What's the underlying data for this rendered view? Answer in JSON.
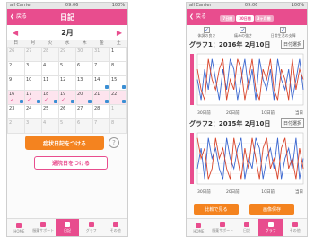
{
  "status_bar": {
    "carrier": "all Carrier",
    "time": "09:06",
    "battery": "100%"
  },
  "diary": {
    "back": "戻る",
    "title": "日記",
    "month": "2月",
    "prev": "◀",
    "next": "▶",
    "weekdays": [
      "日",
      "月",
      "火",
      "水",
      "木",
      "金",
      "土"
    ],
    "rows": [
      [
        "26",
        "27",
        "28",
        "29",
        "30",
        "31",
        "1"
      ],
      [
        "2",
        "3",
        "4",
        "5",
        "6",
        "7",
        "8"
      ],
      [
        "9",
        "10",
        "11",
        "12",
        "13",
        "14",
        "15"
      ],
      [
        "16",
        "17",
        "18",
        "19",
        "20",
        "21",
        "22"
      ],
      [
        "23",
        "24",
        "25",
        "26",
        "27",
        "28",
        "1"
      ],
      [
        "2",
        "3",
        "4",
        "5",
        "6",
        "7",
        "8"
      ]
    ],
    "symptom_button": "症状日記をつける",
    "visit_button": "通院日をつける",
    "help": "?"
  },
  "tabs": [
    {
      "label": "HOME"
    },
    {
      "label": "服薬サポート"
    },
    {
      "label": "日記"
    },
    {
      "label": "グラフ"
    },
    {
      "label": "その他"
    }
  ],
  "graph": {
    "back": "戻る",
    "segments": [
      "7日間",
      "30日間",
      "3ヶ月間"
    ],
    "legend": [
      "体調の良さ",
      "痛みの強さ",
      "日常生活の支障"
    ],
    "graph1_title": "グラフ1：2016年 2月10日",
    "graph2_title": "グラフ2：2015年 2月10日",
    "date_select": "日付選択",
    "tick_labels": [
      "30日前",
      "20日前",
      "10日前",
      "当日"
    ],
    "compare_button": "比較で見る",
    "zoom_button": "画像保存",
    "colors": {
      "accent": "#e84d8e",
      "orange": "#f4831f",
      "blue": "#3b67d0",
      "red": "#d9452b"
    }
  },
  "chart_data": [
    {
      "type": "line",
      "x": [
        1,
        2,
        3,
        4,
        5,
        6,
        7,
        8,
        9,
        10,
        11,
        12,
        13,
        14,
        15,
        16,
        17,
        18,
        19,
        20,
        21,
        22,
        23,
        24,
        25,
        26,
        27,
        28,
        29,
        30
      ],
      "series": [
        {
          "values": [
            3,
            1,
            4,
            2,
            5,
            3,
            1,
            4,
            2,
            5,
            4,
            1,
            3,
            5,
            2,
            4,
            1,
            5,
            3,
            2,
            4,
            1,
            5,
            3,
            2,
            4,
            1,
            3,
            5,
            2
          ]
        },
        {
          "values": [
            4,
            2,
            1,
            5,
            3,
            2,
            4,
            5,
            1,
            3,
            2,
            5,
            4,
            1,
            3,
            5,
            2,
            1,
            4,
            3,
            5,
            2,
            1,
            4,
            3,
            1,
            5,
            2,
            4,
            3
          ]
        }
      ]
    },
    {
      "type": "line",
      "x": [
        1,
        2,
        3,
        4,
        5,
        6,
        7,
        8,
        9,
        10,
        11,
        12,
        13,
        14,
        15,
        16,
        17,
        18,
        19,
        20,
        21,
        22,
        23,
        24,
        25,
        26,
        27,
        28,
        29,
        30
      ],
      "series": [
        {
          "values": [
            2,
            4,
            1,
            5,
            3,
            4,
            2,
            1,
            5,
            3,
            2,
            4,
            5,
            1,
            3,
            2,
            5,
            4,
            1,
            3,
            4,
            2,
            5,
            1,
            3,
            4,
            2,
            5,
            1,
            3
          ]
        },
        {
          "values": [
            5,
            3,
            4,
            1,
            2,
            5,
            3,
            4,
            2,
            1,
            5,
            3,
            1,
            4,
            2,
            5,
            3,
            1,
            4,
            5,
            2,
            3,
            1,
            4,
            5,
            2,
            3,
            1,
            4,
            2
          ]
        }
      ]
    }
  ]
}
